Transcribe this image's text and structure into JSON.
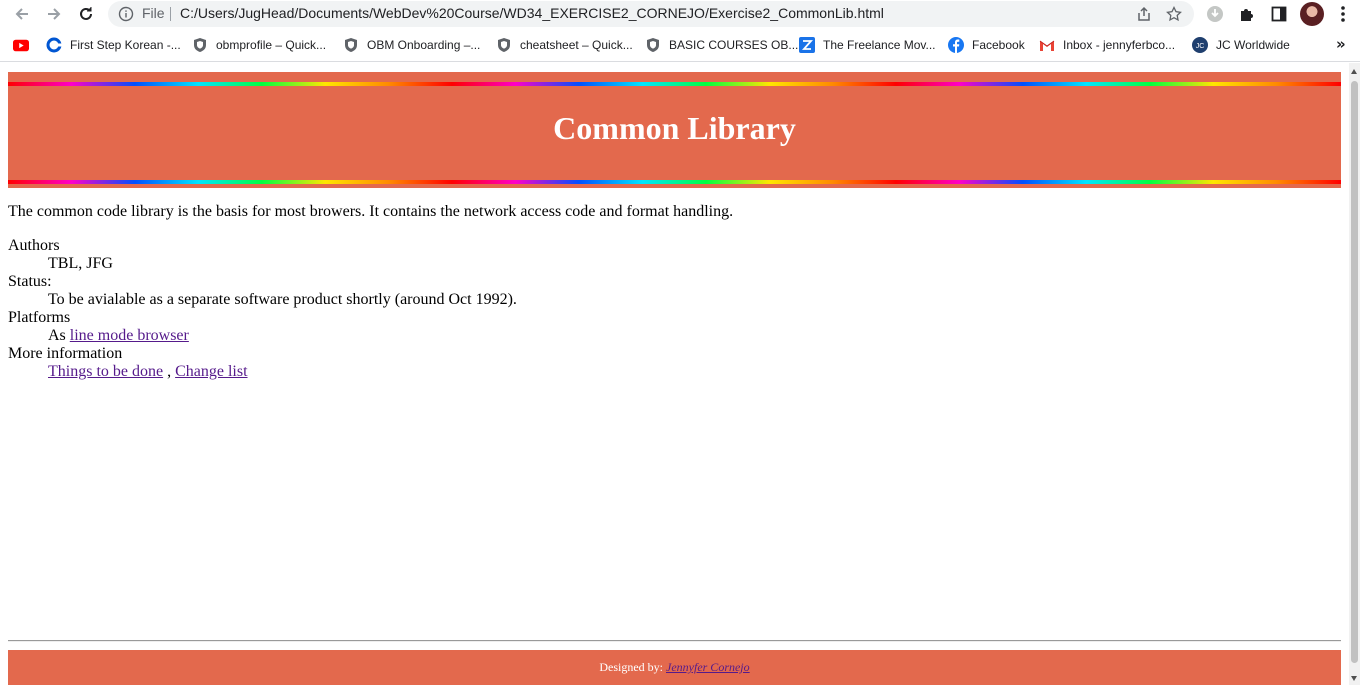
{
  "browser": {
    "omnibox": {
      "scheme_label": "File",
      "url": "C:/Users/JugHead/Documents/WebDev%20Course/WD34_EXERCISE2_CORNEJO/Exercise2_CommonLib.html"
    },
    "bookmarks": [
      {
        "label": "",
        "icon": "youtube-icon"
      },
      {
        "label": "First Step Korean -...",
        "icon": "coursera-icon"
      },
      {
        "label": "obmprofile – Quick...",
        "icon": "shield-icon"
      },
      {
        "label": "OBM Onboarding –...",
        "icon": "shield-icon"
      },
      {
        "label": "cheatsheet – Quick...",
        "icon": "shield-icon"
      },
      {
        "label": "BASIC COURSES OB...",
        "icon": "shield-icon"
      },
      {
        "label": "The Freelance Mov...",
        "icon": "freelance-icon"
      },
      {
        "label": "Facebook",
        "icon": "facebook-icon"
      },
      {
        "label": "Inbox - jennyferbco...",
        "icon": "gmail-icon"
      },
      {
        "label": "JC Worldwide",
        "icon": "jc-icon"
      }
    ],
    "bookmarks_more": "»"
  },
  "page": {
    "title": "Common Library",
    "intro": "The common code library is the basis for most browers. It contains the network access code and format handling.",
    "details": [
      {
        "term": "Authors",
        "desc": [
          {
            "text": "TBL, JFG"
          }
        ]
      },
      {
        "term": "Status:",
        "desc": [
          {
            "text": "To be avialable as a separate software product shortly (around Oct 1992)."
          }
        ]
      },
      {
        "term": "Platforms",
        "desc": [
          {
            "text": "As "
          },
          {
            "link": "line mode browser"
          }
        ]
      },
      {
        "term": "More information",
        "desc": [
          {
            "link": "Things to be done"
          },
          {
            "text": " , "
          },
          {
            "link": "Change list"
          }
        ]
      }
    ],
    "footer": {
      "prefix": "Designed by:",
      "author": "Jennyfer Cornejo"
    }
  },
  "colors": {
    "header_bg": "#e3694d",
    "link": "#551a8b"
  }
}
